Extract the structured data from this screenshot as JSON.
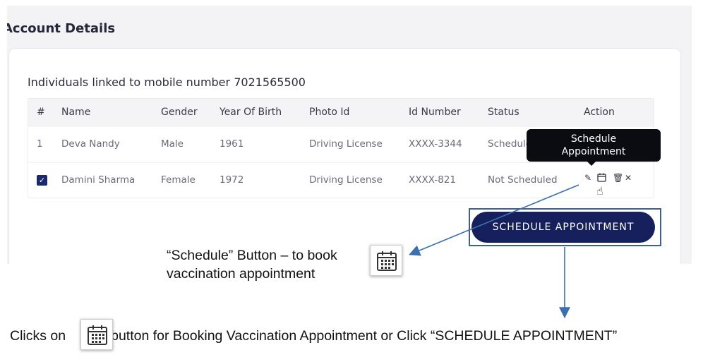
{
  "page": {
    "title": "Account Details"
  },
  "linked": {
    "title": "Individuals linked to mobile number 7021565500"
  },
  "table": {
    "headers": [
      "#",
      "Name",
      "Gender",
      "Year Of Birth",
      "Photo Id",
      "Id Number",
      "Status",
      "Action"
    ],
    "rows": [
      {
        "index": "1",
        "name": "Deva Nandy",
        "gender": "Male",
        "year": "1961",
        "photo_id": "Driving License",
        "id_number": "XXXX-3344",
        "status": "Scheduled"
      },
      {
        "index": "",
        "name": "Damini Sharma",
        "gender": "Female",
        "year": "1972",
        "photo_id": "Driving License",
        "id_number": "XXXX-821",
        "status": "Not Scheduled",
        "checked": true
      }
    ]
  },
  "actions": {
    "edit_icon": "pencil-icon",
    "schedule_icon": "calendar-icon",
    "delete_icon": "trash-icon",
    "remove_icon": "close-icon"
  },
  "tooltip": {
    "line1": "Schedule",
    "line2": "Appointment"
  },
  "button": {
    "schedule_label": "SCHEDULE APPOINTMENT"
  },
  "annotations": {
    "callout1_line1": "“Schedule” Button – to book",
    "callout1_line2": "vaccination appointment",
    "callout2_prefix": "Clicks on",
    "callout2_suffix": "button for Booking Vaccination Appointment or Click “SCHEDULE APPOINTMENT”"
  },
  "colors": {
    "primary": "#16205c",
    "annotation_blue": "#3b6fb0",
    "tooltip_bg": "#0b0b12"
  }
}
